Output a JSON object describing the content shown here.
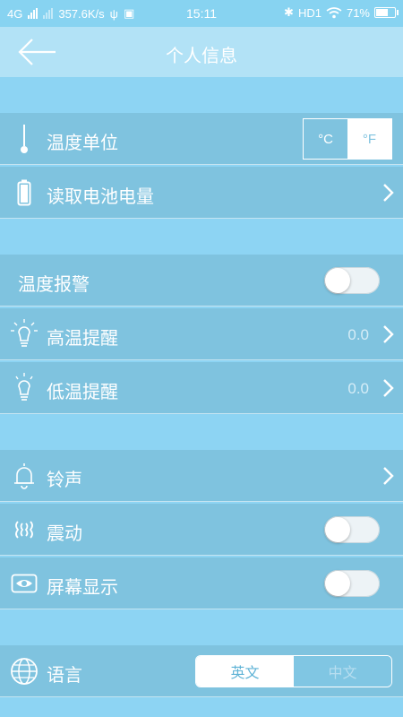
{
  "status_bar": {
    "network": "4G",
    "speed": "357.6K/s",
    "time": "15:11",
    "hd": "HD1",
    "battery": "71%",
    "battery_level": 0.71
  },
  "header": {
    "title": "个人信息"
  },
  "rows": {
    "temp_unit": {
      "label": "温度单位",
      "celsius": "°C",
      "fahrenheit": "°F",
      "selected": "°F"
    },
    "battery_read": {
      "label": "读取电池电量"
    },
    "temp_alarm": {
      "label": "温度报警",
      "on": false
    },
    "high_temp": {
      "label": "高温提醒",
      "value": "0.0"
    },
    "low_temp": {
      "label": "低温提醒",
      "value": "0.0"
    },
    "ringtone": {
      "label": "铃声"
    },
    "vibrate": {
      "label": "震动",
      "on": false
    },
    "screen_display": {
      "label": "屏幕显示",
      "on": false
    },
    "language": {
      "label": "语言",
      "english": "英文",
      "chinese": "中文",
      "selected": "英文"
    }
  },
  "icons": [
    "back-arrow-icon",
    "thermometer-icon",
    "battery-icon",
    "lightbulb-icon",
    "bell-icon",
    "vibrate-icon",
    "eye-icon",
    "globe-icon",
    "chevron-right-icon"
  ],
  "colors": {
    "background": "#8dd4f3",
    "row": "#7fc3df",
    "navbar": "#b2e2f6"
  }
}
